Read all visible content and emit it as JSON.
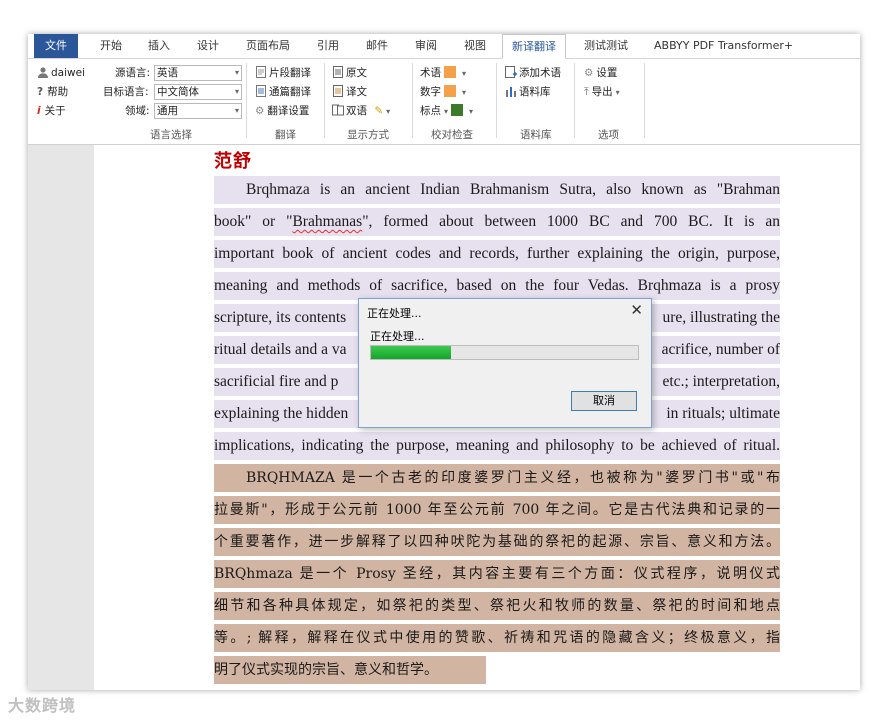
{
  "menu_tabs": {
    "file": "文件",
    "home": "开始",
    "insert": "插入",
    "design": "设计",
    "layout": "页面布局",
    "references": "引用",
    "mailings": "邮件",
    "review": "审阅",
    "view": "视图",
    "xinyi": "新译翻译",
    "test": "测试测试",
    "abbyy": "ABBYY PDF Transformer+"
  },
  "account": {
    "user": "daiwei",
    "help": "帮助",
    "about": "关于"
  },
  "lang_select": {
    "source_label": "源语言:",
    "source_value": "英语",
    "target_label": "目标语言:",
    "target_value": "中文简体",
    "domain_label": "领域:",
    "domain_value": "通用",
    "group_label": "语言选择"
  },
  "translate_group": {
    "fragment": "片段翻译",
    "full_text": "通篇翻译",
    "settings": "翻译设置",
    "group_label": "翻译"
  },
  "display_group": {
    "original": "原文",
    "translation": "译文",
    "bilingual": "双语",
    "group_label": "显示方式"
  },
  "proofread_group": {
    "term": "术语",
    "number": "数字",
    "punct": "标点",
    "group_label": "校对检查",
    "colors": {
      "term": "#f5a04a",
      "number": "#f5a04a",
      "punct": "#3d7a2a"
    }
  },
  "corpus_group": {
    "add_term": "添加术语",
    "corpus": "语料库",
    "group_label": "语料库"
  },
  "options_group": {
    "settings": "设置",
    "export": "导出",
    "group_label": "选项"
  },
  "document": {
    "heading": "范舒",
    "en_lines": [
      "Brqhmaza is an ancient Indian Brahmanism Sutra, also known as \"Brahman",
      "important book of ancient codes and records, further explaining the origin, purpose,",
      "meaning and methods of sacrifice, based on the four Vedas. Brqhmaza is a prosy"
    ],
    "en_line2_pre": "book\" or \"",
    "en_line2_word": "Brahmanas",
    "en_line2_post": "\", formed about between 1000 BC and 700 BC. It is an",
    "en_partial": {
      "l5_left": "scripture, its contents",
      "l5_right": "ure, illustrating the",
      "l6_left": "ritual details and a va",
      "l6_right": "acrifice, number of",
      "l7_left": "sacrificial fire and p",
      "l7_right": "etc.; interpretation,",
      "l8_left": "explaining the hidden",
      "l8_right": "in rituals; ultimate"
    },
    "en_last": "implications, indicating the purpose, meaning and philosophy to be achieved of ritual.",
    "zh_lines": [
      "BRQHMAZA 是一个古老的印度婆罗门主义经，也被称为\"婆罗门书\"或\"布",
      "拉曼斯\"，形成于公元前 1000 年至公元前 700 年之间。它是古代法典和记录的一",
      "个重要著作，进一步解释了以四种吠陀为基础的祭祀的起源、宗旨、意义和方法。",
      "BRQhmaza 是一个 Prosy 圣经，其内容主要有三个方面：仪式程序，说明仪式",
      "细节和各种具体规定，如祭祀的类型、祭祀火和牧师的数量、祭祀的时间和地点",
      "等。; 解释，解释在仪式中使用的赞歌、祈祷和咒语的隐藏含义；终极意义，指",
      "明了仪式实现的宗旨、意义和哲学。"
    ]
  },
  "dialog": {
    "title": "正在处理...",
    "message": "正在处理...",
    "progress": 0.3,
    "cancel": "取消"
  },
  "watermark": "大数跨境"
}
